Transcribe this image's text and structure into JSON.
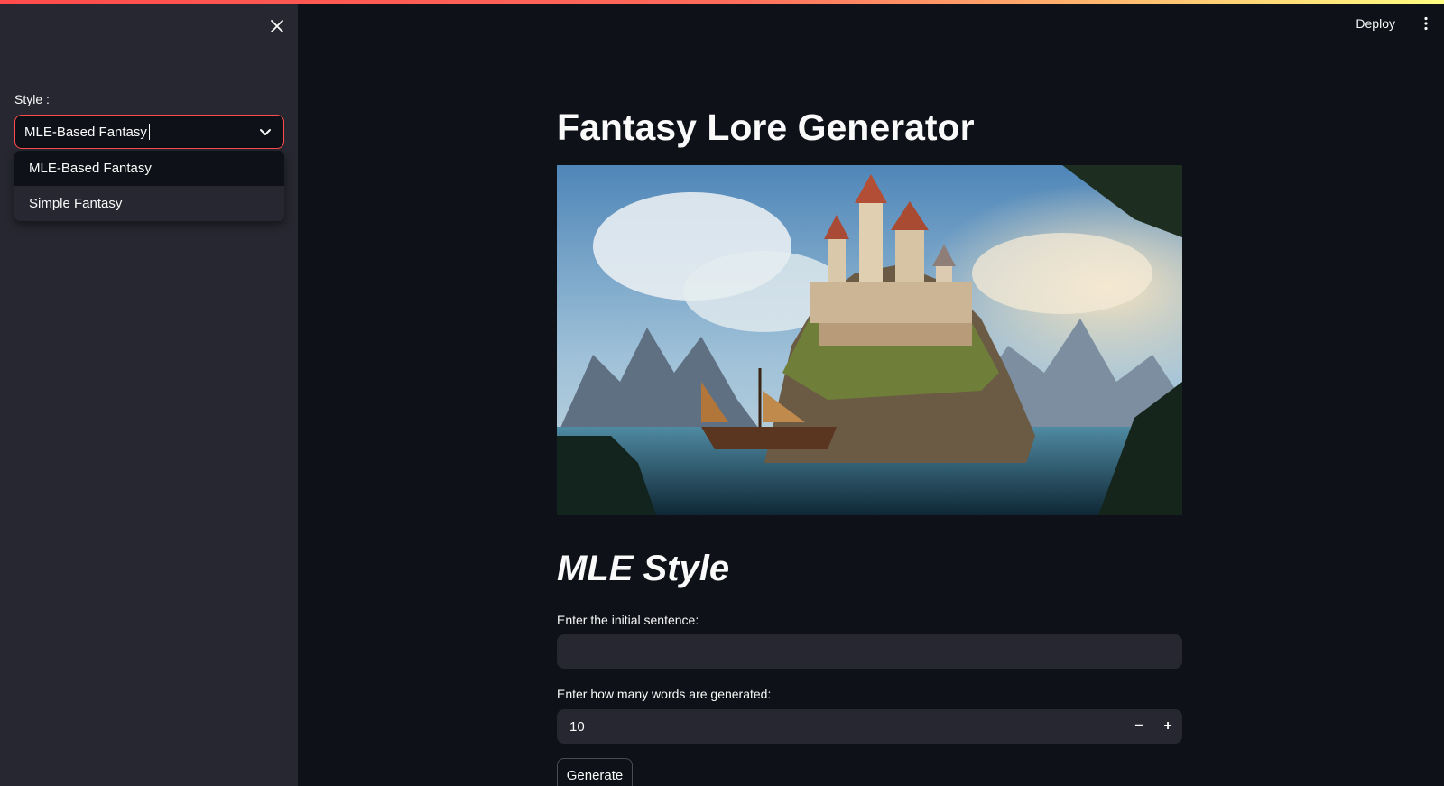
{
  "app": {
    "accent_color": "#ff4b4b",
    "background_color": "#0e1117",
    "sidebar_color": "#262730"
  },
  "header": {
    "deploy_label": "Deploy",
    "menu_icon": "vertical-ellipsis-icon"
  },
  "sidebar": {
    "close_icon": "close-icon",
    "style_label": "Style :",
    "select": {
      "value": "MLE-Based Fantasy",
      "options": [
        "MLE-Based Fantasy",
        "Simple Fantasy"
      ],
      "highlighted_option": "Simple Fantasy"
    }
  },
  "main": {
    "title": "Fantasy Lore Generator",
    "hero_image": "fantasy castle on a cliff island with a sailing ship",
    "section_title": "MLE Style",
    "sentence_label": "Enter the initial sentence:",
    "sentence_value": "",
    "words_label": "Enter how many words are generated:",
    "words_value": "10",
    "minus_label": "−",
    "plus_label": "+",
    "generate_label": "Generate"
  }
}
